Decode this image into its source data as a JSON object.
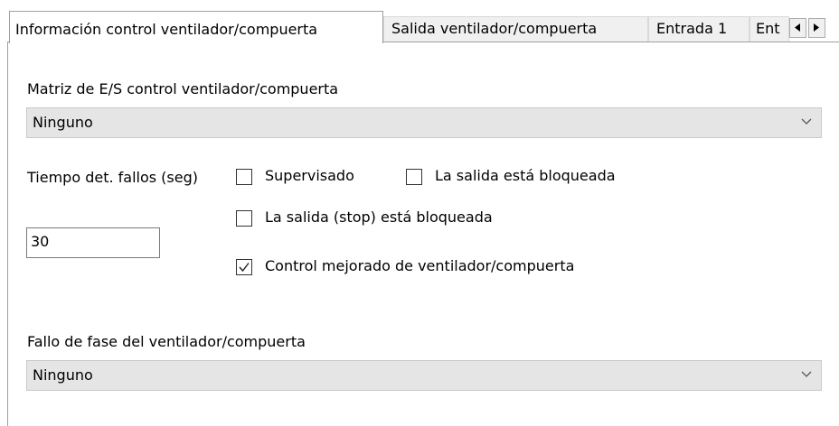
{
  "tabs": [
    {
      "label": "Información control ventilador/compuerta",
      "active": true
    },
    {
      "label": "Salida ventilador/compuerta",
      "active": false
    },
    {
      "label": "Entrada 1",
      "active": false
    },
    {
      "label": "Ent",
      "active": false
    }
  ],
  "tab_scroll": {
    "left_icon": "arrow-left-icon",
    "right_icon": "arrow-right-icon"
  },
  "io_matrix": {
    "label": "Matriz de E/S control ventilador/compuerta",
    "value": "Ninguno",
    "icon": "chevron-down-icon"
  },
  "fault_time": {
    "label": "Tiempo det. fallos (seg)",
    "value": "30"
  },
  "checkboxes": {
    "supervised": {
      "label": "Supervisado",
      "checked": false
    },
    "output_locked": {
      "label": "La salida está bloqueada",
      "checked": false
    },
    "stop_output_locked": {
      "label": "La salida (stop) está bloqueada",
      "checked": false
    },
    "improved_control": {
      "label": "Control mejorado de ventilador/compuerta",
      "checked": true
    }
  },
  "phase_fault": {
    "label": "Fallo de fase del ventilador/compuerta",
    "value": "Ninguno",
    "icon": "chevron-down-icon"
  },
  "colors": {
    "combo_bg": "#e5e5e5",
    "tab_border": "#a0a0a0",
    "inactive_tab_bg": "#f0f0f0"
  }
}
